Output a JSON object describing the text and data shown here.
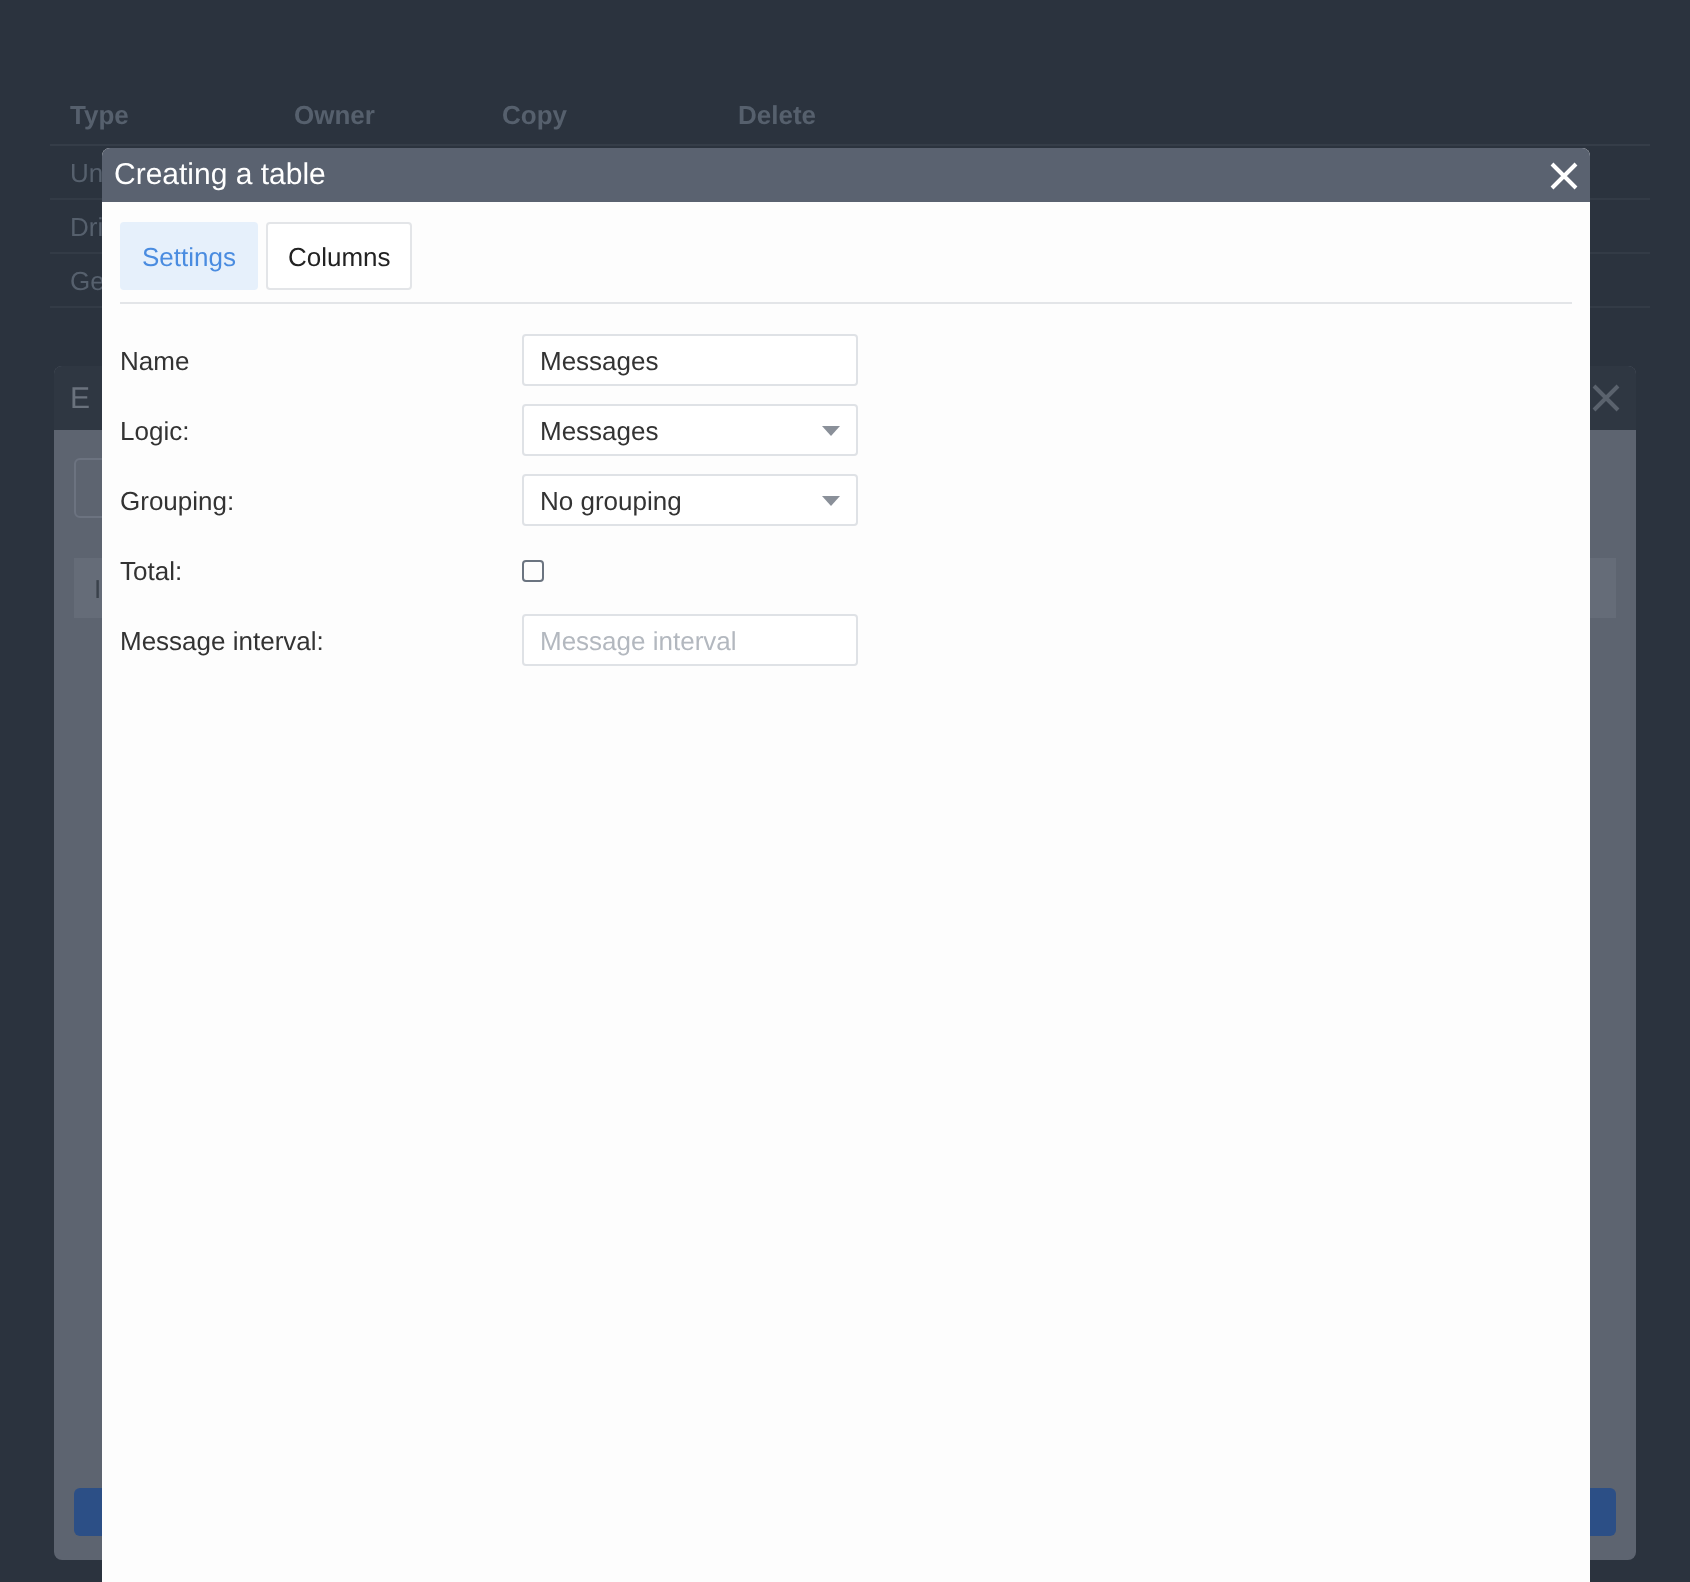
{
  "background_table": {
    "columns": [
      "Type",
      "Owner",
      "Copy",
      "Delete"
    ],
    "rows": [
      "Un",
      "Dri",
      "Ge"
    ]
  },
  "background_dialog": {
    "title": "E",
    "column": "I"
  },
  "dialog": {
    "title": "Creating a table",
    "tabs": [
      {
        "label": "Settings",
        "selected": true
      },
      {
        "label": "Columns",
        "selected": false
      }
    ],
    "fields": [
      {
        "kind": "text",
        "label": "Name",
        "value": "Messages"
      },
      {
        "kind": "select",
        "label": "Logic:",
        "value": "Messages"
      },
      {
        "kind": "select",
        "label": "Grouping:",
        "value": "No grouping"
      },
      {
        "kind": "checkbox",
        "label": "Total:",
        "checked": false
      },
      {
        "kind": "text",
        "label": "Message interval:",
        "placeholder": "Message interval"
      }
    ]
  }
}
